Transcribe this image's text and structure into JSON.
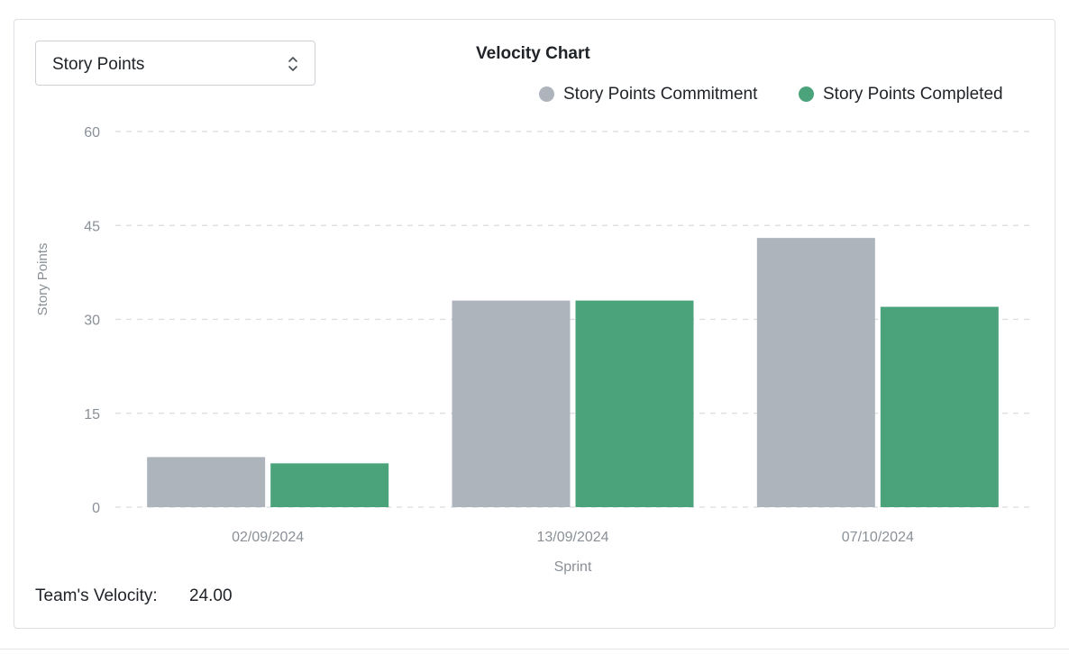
{
  "selector": {
    "value": "Story Points"
  },
  "chart_data": {
    "type": "bar",
    "title": "Velocity Chart",
    "xlabel": "Sprint",
    "ylabel": "Story Points",
    "ylim": [
      0,
      60
    ],
    "yticks": [
      0,
      15,
      30,
      45,
      60
    ],
    "grid": true,
    "legend_position": "top-right",
    "categories": [
      "02/09/2024",
      "13/09/2024",
      "07/10/2024"
    ],
    "series": [
      {
        "name": "Story Points Commitment",
        "color": "#adb4bc",
        "values": [
          8,
          33,
          43
        ]
      },
      {
        "name": "Story Points Completed",
        "color": "#4ba37b",
        "values": [
          7,
          33,
          32
        ]
      }
    ]
  },
  "summary": {
    "velocity_label": "Team's Velocity:",
    "velocity_value": "24.00"
  }
}
